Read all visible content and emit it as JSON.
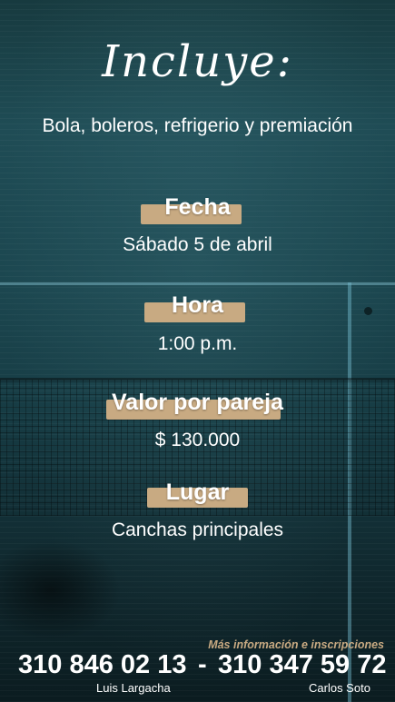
{
  "header": {
    "title": "Incluye:",
    "subtitle": "Bola, boleros, refrigerio y premiación"
  },
  "sections": [
    {
      "label": "Fecha",
      "value": "Sábado 5 de abril"
    },
    {
      "label": "Hora",
      "value": "1:00 p.m."
    },
    {
      "label": "Valor por pareja",
      "value": "$ 130.000"
    },
    {
      "label": "Lugar",
      "value": "Canchas principales"
    }
  ],
  "footer": {
    "info_text": "Más información e inscripciones",
    "separator": "-",
    "contacts": [
      {
        "phone": "310 846 02 13",
        "name": "Luis Largacha"
      },
      {
        "phone": "310 347 59 72",
        "name": "Carlos Soto"
      }
    ]
  },
  "colors": {
    "label_background": "#c8aa82",
    "background_dark": "#10282e",
    "background_teal": "#1f4c55",
    "text": "#ffffff"
  }
}
